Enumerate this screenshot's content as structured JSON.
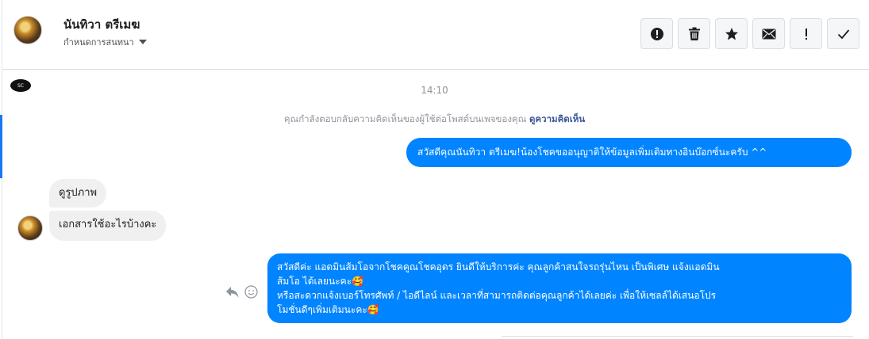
{
  "header": {
    "contact_name": "นันทิวา ตรีเมฆ",
    "conversation_settings_label": "กำหนดการสนทนา",
    "toolbar": [
      {
        "name": "spam-button",
        "icon": "exclamation-circle-icon"
      },
      {
        "name": "delete-button",
        "icon": "trash-icon"
      },
      {
        "name": "star-button",
        "icon": "star-icon"
      },
      {
        "name": "mark-unread-button",
        "icon": "envelope-icon"
      },
      {
        "name": "follow-up-button",
        "icon": "exclamation-icon"
      },
      {
        "name": "mark-done-button",
        "icon": "check-icon"
      }
    ]
  },
  "conversation": {
    "timestamp": "14:10",
    "notice": "คุณกำลังตอบกลับความคิดเห็นของผู้ใช้ต่อโพสต์บนเพจของคุณ",
    "notice_link": "ดูความคิดเห็น",
    "page_logo_text": "SC",
    "messages": [
      {
        "from": "page",
        "text": "สวัสดีคุณนันทิวา ตรีเมฆ!น้องโชคขออนุญาติให้ข้อมูลเพิ่มเติมทางอินบ๊อกซ์นะครับ ^^"
      },
      {
        "from": "user",
        "text": "ดูรูปภาพ"
      },
      {
        "from": "user",
        "text": "เอกสารใช้อะไรบ้างคะ"
      },
      {
        "from": "page",
        "lines": [
          "สวัสดีค่ะ แอดมินส้มโอจากโชคคูณโชคอุดร ยินดีให้บริการค่ะ   คุณลูกค้าสนใจรถรุ่นไหน เป็นพิเศษ แจ้งแอดมิน",
          "ส้มโอ ได้เลยนะคะ🥰",
          "หรือสะดวกแจ้งเบอร์โทรศัพท์ / ไอดีไลน์ และเวลาที่สามารถติดต่อคุณลูกค้าได้เลยค่ะ เพื่อให้เซลล์ได้เสนอโปร",
          "โมชั่นดีๆเพิ่มเติมนะคะ🥰"
        ]
      }
    ]
  },
  "colors": {
    "accent": "#0084ff",
    "incoming_bubble": "#f1f0f0",
    "link": "#385898",
    "muted": "#90949c"
  }
}
